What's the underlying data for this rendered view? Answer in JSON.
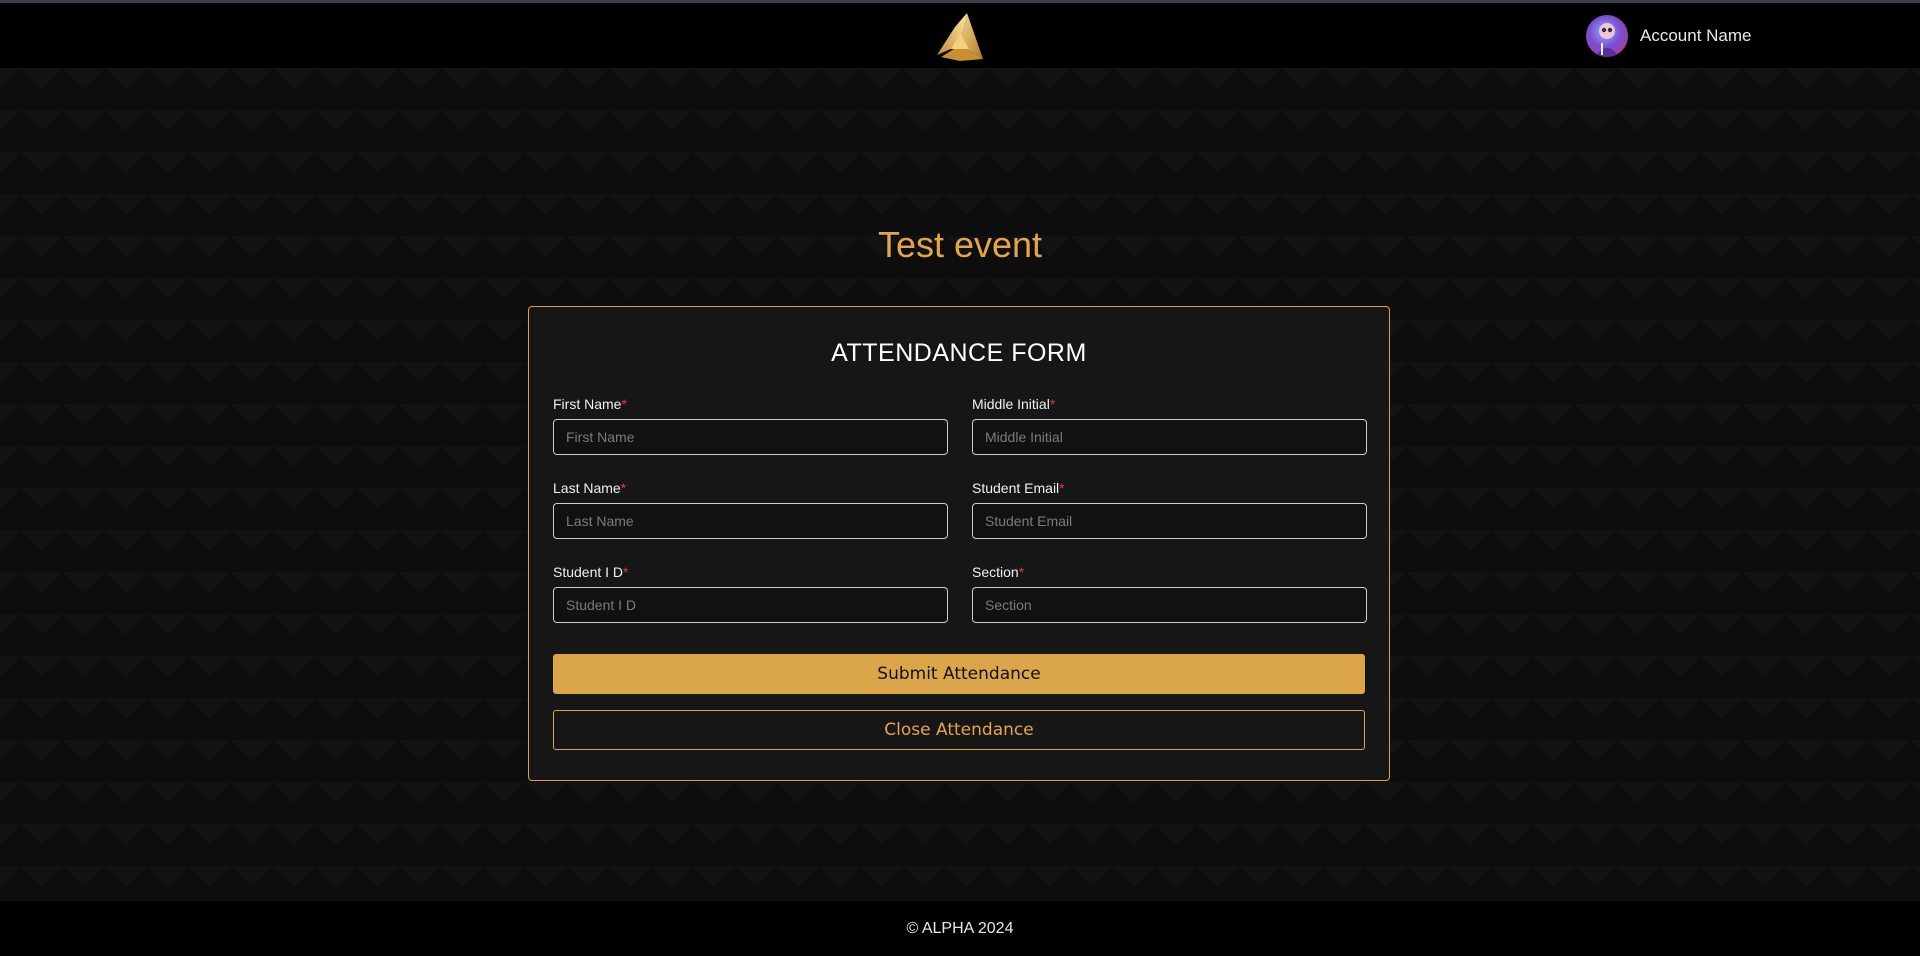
{
  "header": {
    "account_name": "Account Name"
  },
  "event": {
    "title": "Test event"
  },
  "form": {
    "title": "ATTENDANCE FORM",
    "required_marker": "*",
    "fields": {
      "first_name": {
        "label": "First Name",
        "placeholder": "First Name"
      },
      "middle_initial": {
        "label": "Middle Initial",
        "placeholder": "Middle Initial"
      },
      "last_name": {
        "label": "Last Name",
        "placeholder": "Last Name"
      },
      "student_email": {
        "label": "Student Email",
        "placeholder": "Student Email"
      },
      "student_id": {
        "label": "Student I D",
        "placeholder": "Student I D"
      },
      "section": {
        "label": "Section",
        "placeholder": "Section"
      }
    },
    "submit_label": "Submit Attendance",
    "close_label": "Close Attendance"
  },
  "footer": {
    "copyright": "© ALPHA 2024"
  },
  "colors": {
    "accent": "#dba54a",
    "required": "#e33b3b",
    "background": "#0e0e0e"
  }
}
